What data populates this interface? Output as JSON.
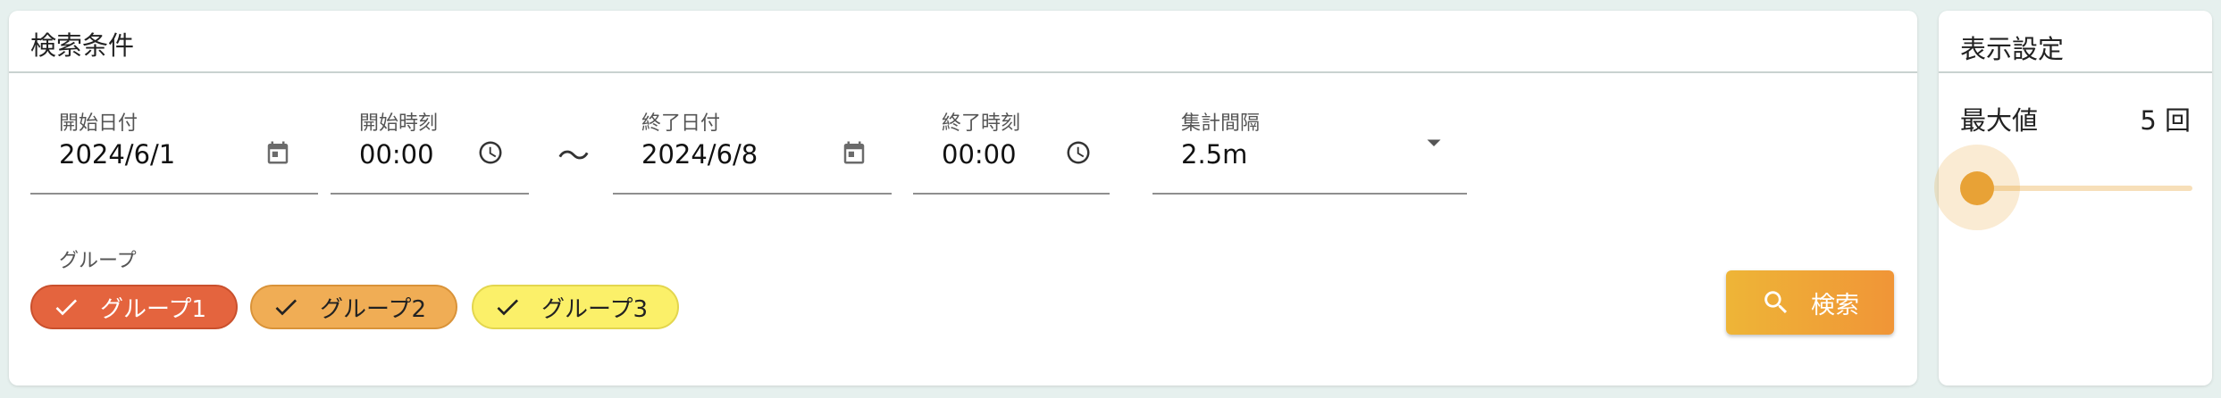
{
  "search_panel": {
    "title": "検索条件",
    "start_date": {
      "label": "開始日付",
      "value": "2024/6/1",
      "icon": "calendar-icon"
    },
    "start_time": {
      "label": "開始時刻",
      "value": "00:00",
      "icon": "clock-icon"
    },
    "range_separator": "～",
    "end_date": {
      "label": "終了日付",
      "value": "2024/6/8",
      "icon": "calendar-icon"
    },
    "end_time": {
      "label": "終了時刻",
      "value": "00:00",
      "icon": "clock-icon"
    },
    "interval": {
      "label": "集計間隔",
      "value": "2.5m",
      "icon": "dropdown-arrow-icon"
    },
    "group_label": "グループ",
    "groups": [
      {
        "label": "グループ1",
        "selected": true,
        "color": "#e4643e",
        "border": "#c9502d",
        "text_color": "#ffffff"
      },
      {
        "label": "グループ2",
        "selected": true,
        "color": "#f0ad55",
        "border": "#d99339",
        "text_color": "#222222"
      },
      {
        "label": "グループ3",
        "selected": true,
        "color": "#fbf069",
        "border": "#e3d64e",
        "text_color": "#222222"
      }
    ],
    "search_button": {
      "label": "検索",
      "icon": "search-icon"
    }
  },
  "display_panel": {
    "title": "表示設定",
    "max_label": "最大値",
    "max_value": "5 回",
    "slider": {
      "value": 5,
      "min": 5,
      "max": 100,
      "fraction": 0.0,
      "color": "#e8a236"
    }
  },
  "colors": {
    "background": "#e6f0ee",
    "panel": "#ffffff",
    "divider": "#c9d2d0",
    "search_button_start": "#eeb537",
    "search_button_end": "#f09537"
  }
}
